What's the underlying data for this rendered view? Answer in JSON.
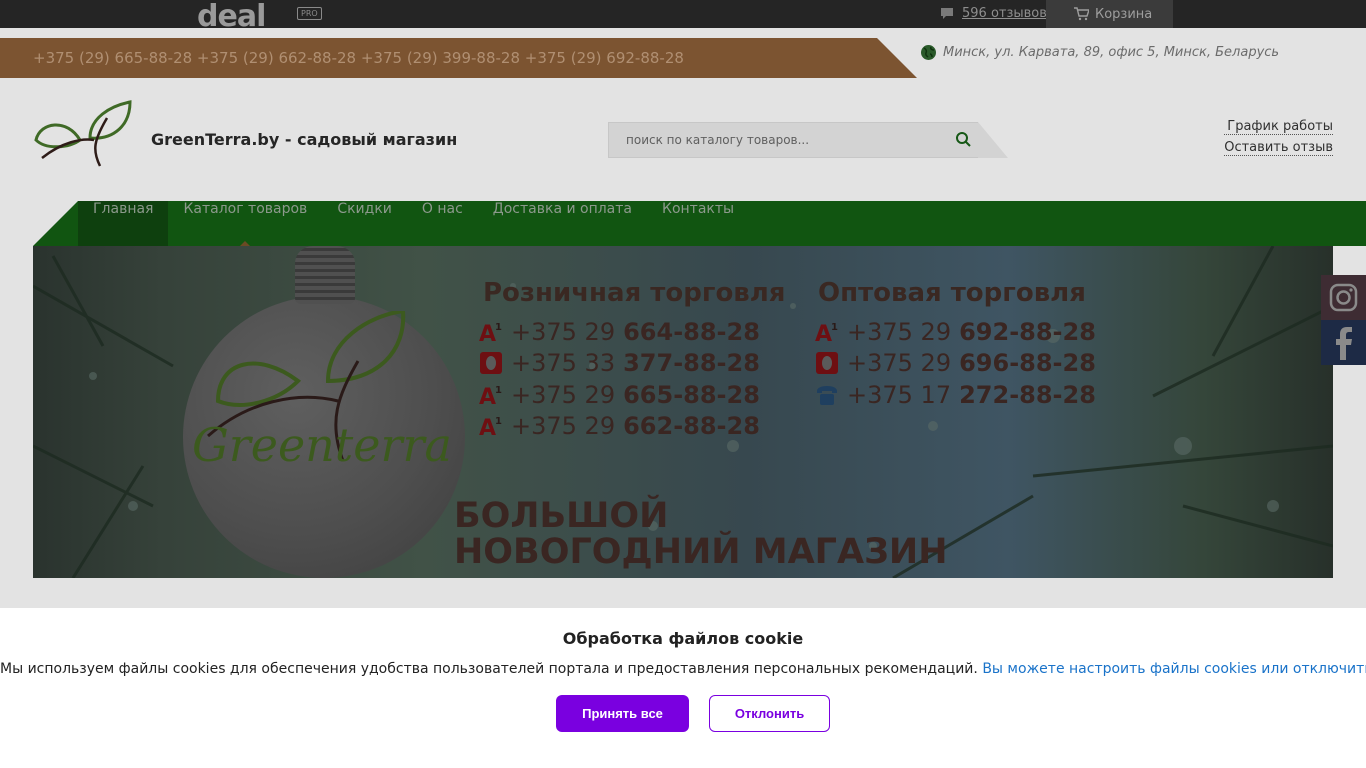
{
  "topbar": {
    "logo_text": "deal",
    "logo_badge": "PRO",
    "reviews_link": "596 отзывов",
    "cart_label": "Корзина"
  },
  "contacts": {
    "phones": "+375 (29) 665-88-28 +375 (29) 662-88-28 +375 (29) 399-88-28 +375 (29) 692-88-28",
    "address": "Минск, ул. Карвата, 89, офис 5, Минск, Беларусь"
  },
  "header": {
    "site_title": "GreenTerra.by - садовый магазин",
    "search_placeholder": "поиск по каталогу товаров...",
    "schedule_link": "График работы",
    "review_link": "Оставить отзыв"
  },
  "nav": {
    "items": [
      {
        "label": "Главная"
      },
      {
        "label": "Каталог товаров"
      },
      {
        "label": "Скидки"
      },
      {
        "label": "О нас"
      },
      {
        "label": "Доставка и оплата"
      },
      {
        "label": "Контакты"
      }
    ]
  },
  "banner": {
    "brand": "Greenterra",
    "retail": {
      "title": "Розничная торговля",
      "phones": [
        {
          "operator": "a1-icon",
          "prefix": "+375 29",
          "number": "664-88-28"
        },
        {
          "operator": "mts-icon",
          "prefix": "+375 33",
          "number": "377-88-28"
        },
        {
          "operator": "a1-icon",
          "prefix": "+375 29",
          "number": "665-88-28"
        },
        {
          "operator": "a1-icon",
          "prefix": "+375 29",
          "number": "662-88-28"
        }
      ]
    },
    "wholesale": {
      "title": "Оптовая торговля",
      "phones": [
        {
          "operator": "a1-icon",
          "prefix": "+375 29",
          "number": "692-88-28"
        },
        {
          "operator": "mts-icon",
          "prefix": "+375 29",
          "number": "696-88-28"
        },
        {
          "operator": "landline-phone-icon",
          "prefix": "+375 17",
          "number": "272-88-28"
        }
      ]
    },
    "headline_line1": "БОЛЬШОЙ",
    "headline_line2": "НОВОГОДНИЙ МАГАЗИН"
  },
  "cookie": {
    "title": "Обработка файлов cookie",
    "text": "Мы используем файлы cookies для обеспечения удобства пользователей портала и предоставления персональных рекомендаций.",
    "settings_link": "Вы можете настроить файлы cookies или отключить их.",
    "accept_label": "Принять все",
    "decline_label": "Отклонить"
  },
  "colors": {
    "accent_purple": "#7a00e0",
    "link_blue": "#1a73c9",
    "nav_green": "#115511",
    "phone_strip": "#7c5431"
  }
}
